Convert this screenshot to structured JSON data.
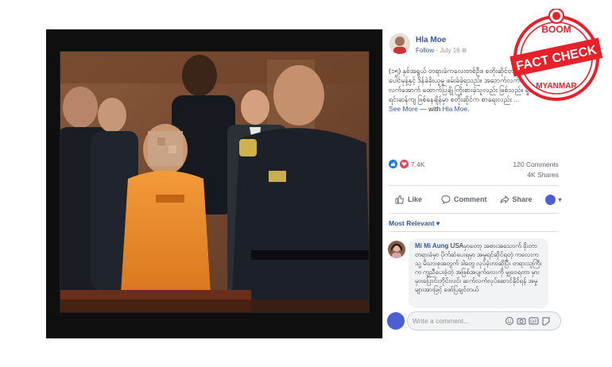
{
  "post": {
    "author": "Hla Moe",
    "follow": "Follow",
    "date": "July 16",
    "text": "(၁၅) နှစ်အရွယ် တရားခံကလေးတစ်ဦး။ စတိုးဆိုင်တစ်ခုမှ ပေါင်မုန့်နှင့် ဒိန်ခဲခိုးယူမှု ဖမ်းခံခဲ့ရသည်။ အဘေက်လက်ကို လက်အောက် ထောက်ပြချို ကြိုးစားခဲ့သူလည်း ဖြစ်သည်။ ရှုံးရင်းဆန်ကျ ဖြစ်နေချိန်မှာ စတိုးဆိုင်က စာရေးလည်း",
    "see_more": "... See More",
    "with_text": " — with ",
    "with_name": "Hla Moe."
  },
  "stats": {
    "reactions": "7.4K",
    "comments": "120 Comments",
    "shares": "4K Shares"
  },
  "actions": {
    "like": "Like",
    "comment": "Comment",
    "share": "Share"
  },
  "comments": {
    "sort": "Most Relevant",
    "sort_arrow": "▾",
    "first_author": "Mi Mi Aung",
    "first_text": "USAမှာတော့ အစားအသောက် ခိုးတာတရားခံမှာ ပိုက်ဆံပေးရမှာ အမှုရင်ဆိုင်ရတဲ့ ကလေးက သူ့ မိသားစုအတွက် ဒါတွေ လုပ်ခဲ့တာဆိုပြီး တရားသူကြီးက ကူညီပေးခဲ့တဲ့ အဖြစ်အပျက်လေးကို မျှဝေရတာ မှားမှားပြောင်းဘိုင်းလင်း ဆက်လက်လုပ်ဆောင်နိုင်ရန် အမှုများအားဖြင့် ဖော်ပြချင်တယ်",
    "input_placeholder": "Write a comment..."
  },
  "stamp": {
    "top": "BOOM",
    "middle": "FACT CHECK",
    "bottom": "MYANMAR"
  },
  "colors": {
    "brand_blue": "#385898",
    "stamp_red": "#e8202a",
    "like_blue": "#2078f4",
    "love_red": "#f33e58"
  }
}
